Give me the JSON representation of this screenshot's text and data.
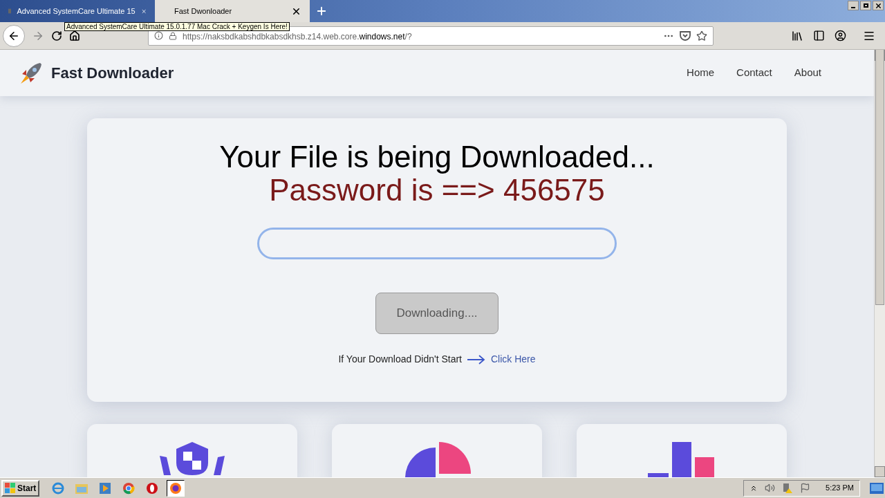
{
  "browser": {
    "tabs": [
      {
        "title": "Advanced SystemCare Ultimate 15",
        "selected": false
      },
      {
        "title": "Fast Dwonloader",
        "selected": true
      }
    ],
    "tooltip": "Advanced SystemCare Ultimate 15.0.1.77 Mac Crack + Keygen Is Here!",
    "url_prefix": "https://naksbdkabshdbkabsdkhsb.z14.web.core.",
    "url_domain": "windows.net",
    "url_suffix": "/?"
  },
  "site": {
    "brand": "Fast Downloader",
    "nav": [
      "Home",
      "Contact",
      "About"
    ]
  },
  "card": {
    "title": "Your File is being Downloaded...",
    "password": "Password is ==> 456575",
    "button": "Downloading....",
    "hint": "If Your Download Didn't Start",
    "link": "Click Here"
  },
  "features": [
    {
      "kind": "shield"
    },
    {
      "kind": "pie"
    },
    {
      "kind": "bars"
    }
  ],
  "taskbar": {
    "start": "Start",
    "apps": [
      {
        "kind": "ie",
        "selected": false
      },
      {
        "kind": "folder",
        "selected": false
      },
      {
        "kind": "media",
        "selected": false
      },
      {
        "kind": "chrome",
        "selected": false
      },
      {
        "kind": "opera",
        "selected": false
      },
      {
        "kind": "firefox",
        "selected": true
      }
    ],
    "time": "5:23 PM"
  }
}
